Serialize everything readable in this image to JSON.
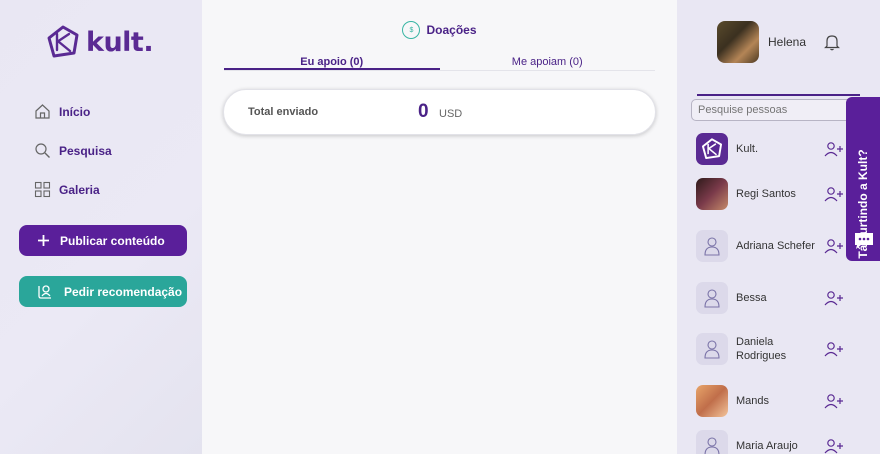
{
  "brand": {
    "name": "kult.",
    "color": "#5a2a93"
  },
  "nav": [
    {
      "label": "Início",
      "icon": "home-icon"
    },
    {
      "label": "Pesquisa",
      "icon": "search-icon"
    },
    {
      "label": "Galeria",
      "icon": "grid-icon"
    }
  ],
  "actions": {
    "publish_label": "Publicar conteúdo",
    "recommend_label": "Pedir recomendação"
  },
  "donations": {
    "title": "Doações",
    "tabs": [
      "Eu apoio (0)",
      "Me apoiam (0)"
    ],
    "total_label": "Total enviado",
    "total_value": "0",
    "currency": "USD"
  },
  "user": {
    "name": "Helena"
  },
  "people_search": {
    "placeholder": "Pesquise pessoas"
  },
  "people": [
    {
      "name": "Kult.",
      "avatar": "kult-logo"
    },
    {
      "name": "Regi Santos",
      "avatar": "photo"
    },
    {
      "name": "Adriana Schefer",
      "avatar": "default"
    },
    {
      "name": "Bessa",
      "avatar": "default"
    },
    {
      "name": "Daniela Rodrigues",
      "avatar": "default"
    },
    {
      "name": "Mands",
      "avatar": "photo"
    },
    {
      "name": "Maria Araujo",
      "avatar": "default"
    }
  ],
  "feedback": {
    "label": "Tá curtindo a Kult?"
  },
  "colors": {
    "accent": "#5a1f9a",
    "teal": "#2aa69a"
  }
}
